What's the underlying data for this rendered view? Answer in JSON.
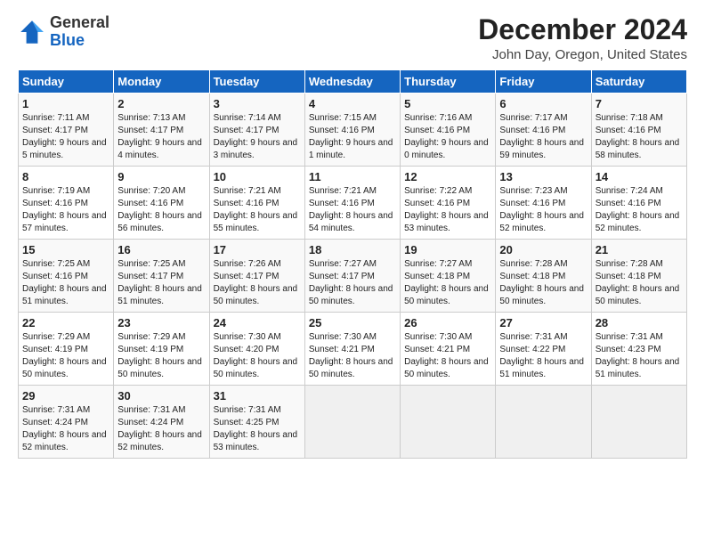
{
  "logo": {
    "general": "General",
    "blue": "Blue"
  },
  "title": "December 2024",
  "location": "John Day, Oregon, United States",
  "days_header": [
    "Sunday",
    "Monday",
    "Tuesday",
    "Wednesday",
    "Thursday",
    "Friday",
    "Saturday"
  ],
  "weeks": [
    [
      {
        "day": "1",
        "sunrise": "7:11 AM",
        "sunset": "4:17 PM",
        "daylight": "9 hours and 5 minutes."
      },
      {
        "day": "2",
        "sunrise": "7:13 AM",
        "sunset": "4:17 PM",
        "daylight": "9 hours and 4 minutes."
      },
      {
        "day": "3",
        "sunrise": "7:14 AM",
        "sunset": "4:17 PM",
        "daylight": "9 hours and 3 minutes."
      },
      {
        "day": "4",
        "sunrise": "7:15 AM",
        "sunset": "4:16 PM",
        "daylight": "9 hours and 1 minute."
      },
      {
        "day": "5",
        "sunrise": "7:16 AM",
        "sunset": "4:16 PM",
        "daylight": "9 hours and 0 minutes."
      },
      {
        "day": "6",
        "sunrise": "7:17 AM",
        "sunset": "4:16 PM",
        "daylight": "8 hours and 59 minutes."
      },
      {
        "day": "7",
        "sunrise": "7:18 AM",
        "sunset": "4:16 PM",
        "daylight": "8 hours and 58 minutes."
      }
    ],
    [
      {
        "day": "8",
        "sunrise": "7:19 AM",
        "sunset": "4:16 PM",
        "daylight": "8 hours and 57 minutes."
      },
      {
        "day": "9",
        "sunrise": "7:20 AM",
        "sunset": "4:16 PM",
        "daylight": "8 hours and 56 minutes."
      },
      {
        "day": "10",
        "sunrise": "7:21 AM",
        "sunset": "4:16 PM",
        "daylight": "8 hours and 55 minutes."
      },
      {
        "day": "11",
        "sunrise": "7:21 AM",
        "sunset": "4:16 PM",
        "daylight": "8 hours and 54 minutes."
      },
      {
        "day": "12",
        "sunrise": "7:22 AM",
        "sunset": "4:16 PM",
        "daylight": "8 hours and 53 minutes."
      },
      {
        "day": "13",
        "sunrise": "7:23 AM",
        "sunset": "4:16 PM",
        "daylight": "8 hours and 52 minutes."
      },
      {
        "day": "14",
        "sunrise": "7:24 AM",
        "sunset": "4:16 PM",
        "daylight": "8 hours and 52 minutes."
      }
    ],
    [
      {
        "day": "15",
        "sunrise": "7:25 AM",
        "sunset": "4:16 PM",
        "daylight": "8 hours and 51 minutes."
      },
      {
        "day": "16",
        "sunrise": "7:25 AM",
        "sunset": "4:17 PM",
        "daylight": "8 hours and 51 minutes."
      },
      {
        "day": "17",
        "sunrise": "7:26 AM",
        "sunset": "4:17 PM",
        "daylight": "8 hours and 50 minutes."
      },
      {
        "day": "18",
        "sunrise": "7:27 AM",
        "sunset": "4:17 PM",
        "daylight": "8 hours and 50 minutes."
      },
      {
        "day": "19",
        "sunrise": "7:27 AM",
        "sunset": "4:18 PM",
        "daylight": "8 hours and 50 minutes."
      },
      {
        "day": "20",
        "sunrise": "7:28 AM",
        "sunset": "4:18 PM",
        "daylight": "8 hours and 50 minutes."
      },
      {
        "day": "21",
        "sunrise": "7:28 AM",
        "sunset": "4:18 PM",
        "daylight": "8 hours and 50 minutes."
      }
    ],
    [
      {
        "day": "22",
        "sunrise": "7:29 AM",
        "sunset": "4:19 PM",
        "daylight": "8 hours and 50 minutes."
      },
      {
        "day": "23",
        "sunrise": "7:29 AM",
        "sunset": "4:19 PM",
        "daylight": "8 hours and 50 minutes."
      },
      {
        "day": "24",
        "sunrise": "7:30 AM",
        "sunset": "4:20 PM",
        "daylight": "8 hours and 50 minutes."
      },
      {
        "day": "25",
        "sunrise": "7:30 AM",
        "sunset": "4:21 PM",
        "daylight": "8 hours and 50 minutes."
      },
      {
        "day": "26",
        "sunrise": "7:30 AM",
        "sunset": "4:21 PM",
        "daylight": "8 hours and 50 minutes."
      },
      {
        "day": "27",
        "sunrise": "7:31 AM",
        "sunset": "4:22 PM",
        "daylight": "8 hours and 51 minutes."
      },
      {
        "day": "28",
        "sunrise": "7:31 AM",
        "sunset": "4:23 PM",
        "daylight": "8 hours and 51 minutes."
      }
    ],
    [
      {
        "day": "29",
        "sunrise": "7:31 AM",
        "sunset": "4:24 PM",
        "daylight": "8 hours and 52 minutes."
      },
      {
        "day": "30",
        "sunrise": "7:31 AM",
        "sunset": "4:24 PM",
        "daylight": "8 hours and 52 minutes."
      },
      {
        "day": "31",
        "sunrise": "7:31 AM",
        "sunset": "4:25 PM",
        "daylight": "8 hours and 53 minutes."
      },
      null,
      null,
      null,
      null
    ]
  ]
}
